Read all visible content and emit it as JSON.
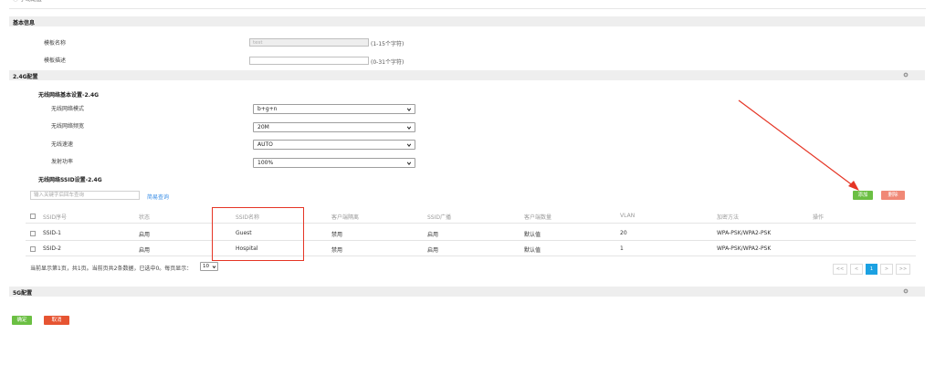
{
  "header": {
    "fragment": "ⓘ 手动配置"
  },
  "basic": {
    "title": "基本信息",
    "template_name_label": "模板名称",
    "template_name_value": "test",
    "template_name_hint": "(1-15个字符)",
    "template_desc_label": "模板描述",
    "template_desc_value": "",
    "template_desc_hint": "(0-31个字符)"
  },
  "band24": {
    "title": "2.4G配置",
    "basic_heading": "无线网络基本设置-2.4G",
    "mode_label": "无线网络模式",
    "mode_value": "b+g+n",
    "width_label": "无线网络频宽",
    "width_value": "20M",
    "rate_label": "无线速速",
    "rate_value": "AUTO",
    "power_label": "发射功率",
    "power_value": "100%",
    "ssid_heading": "无线网络SSID设置-2.4G",
    "search_placeholder": "输入关键字后回车查询",
    "simple_query": "简易查询",
    "add_button": "添加",
    "delete_button": "删除"
  },
  "table": {
    "headers": [
      "SSID序号",
      "状态",
      "SSID名称",
      "客户端隔离",
      "SSID广播",
      "客户端数量",
      "VLAN",
      "加密方法",
      "操作"
    ],
    "rows": [
      [
        "SSID-1",
        "启用",
        "Guest",
        "禁用",
        "启用",
        "默认值",
        "20",
        "WPA-PSK/WPA2-PSK",
        ""
      ],
      [
        "SSID-2",
        "启用",
        "Hospital",
        "禁用",
        "启用",
        "默认值",
        "1",
        "WPA-PSK/WPA2-PSK",
        ""
      ]
    ],
    "summary": "当前显示第1页，共1页。当前页共2条数据，已选中0。每页显示：",
    "page_size": "10",
    "pager": {
      "first": "<<",
      "prev": "<",
      "current": "1",
      "next": ">",
      "last": ">>"
    }
  },
  "band5": {
    "title": "5G配置"
  },
  "footer": {
    "confirm": "确定",
    "cancel": "取消"
  },
  "colors": {
    "accent_blue": "#1ba1e2",
    "green": "#6bbf43",
    "red": "#e65432",
    "annotation_red": "#e53525"
  }
}
